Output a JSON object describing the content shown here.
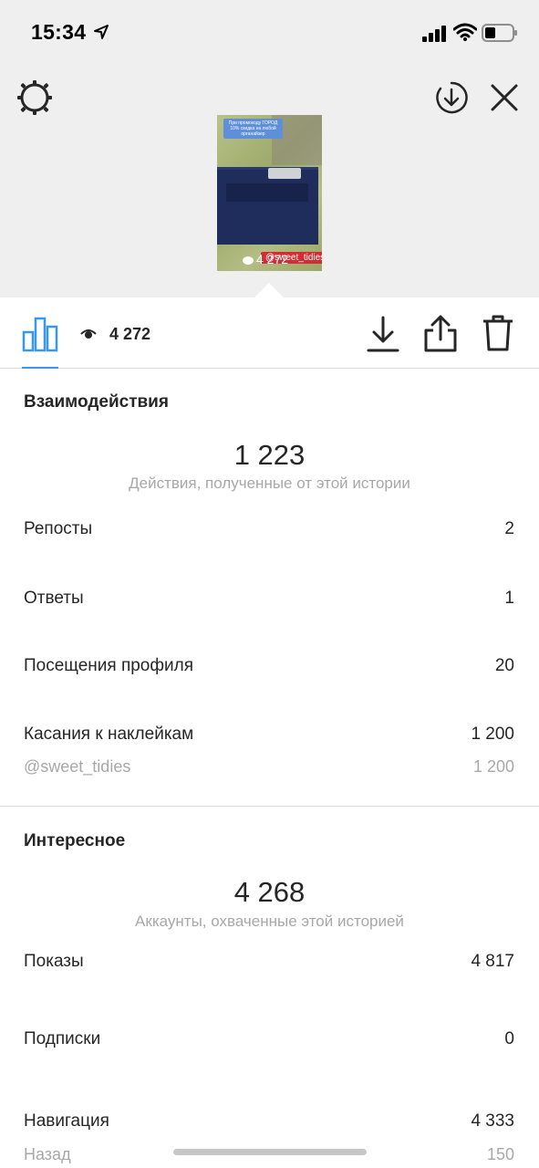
{
  "status_bar": {
    "time": "15:34"
  },
  "thumbnail": {
    "caption": "При промокоду ГОРОД 10% скидка на любой органайзер",
    "tag": "@sweet_tidies",
    "views": "4 272"
  },
  "toolbar": {
    "views": "4 272"
  },
  "interactions": {
    "title": "Взаимодействия",
    "total": "1 223",
    "subtitle": "Действия, полученные от этой истории",
    "rows": [
      {
        "label": "Репосты",
        "value": "2"
      },
      {
        "label": "Ответы",
        "value": "1"
      },
      {
        "label": "Посещения профиля",
        "value": "20"
      },
      {
        "label": "Касания к наклейкам",
        "value": "1 200"
      }
    ],
    "sticker": {
      "label": "@sweet_tidies",
      "value": "1 200"
    }
  },
  "discovery": {
    "title": "Интересное",
    "total": "4 268",
    "subtitle": "Аккаунты, охваченные этой историей",
    "rows": [
      {
        "label": "Показы",
        "value": "4 817"
      },
      {
        "label": "Подписки",
        "value": "0"
      },
      {
        "label": "Навигация",
        "value": "4 333"
      }
    ],
    "sub_row": {
      "label": "Назад",
      "value": "150"
    }
  },
  "colors": {
    "accent": "#3897f0",
    "background_top": "#efefef",
    "muted_text": "#a8a8a8"
  }
}
